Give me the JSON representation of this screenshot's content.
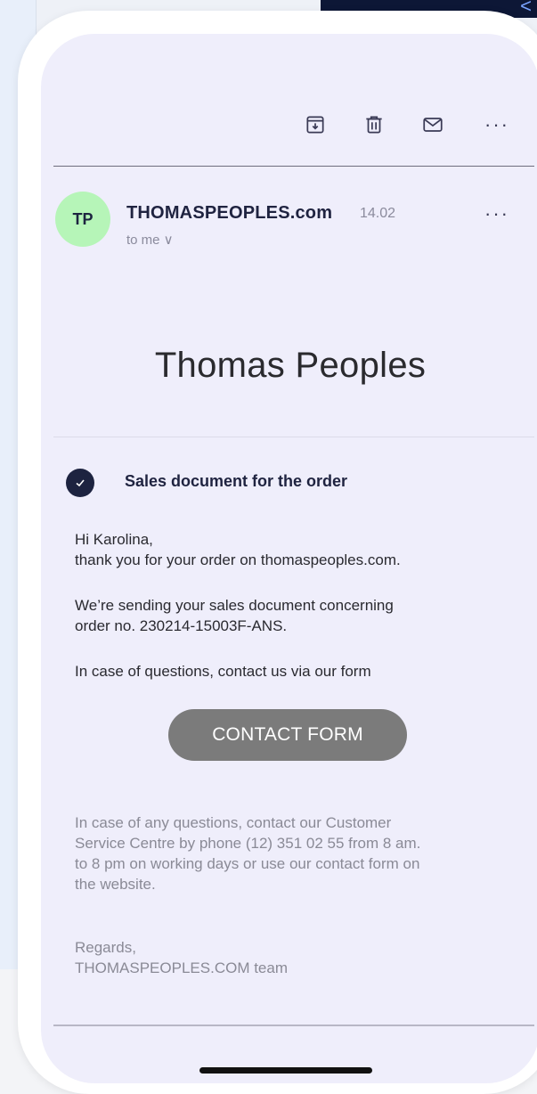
{
  "toolbar": {
    "icons": [
      "archive-icon",
      "trash-icon",
      "mail-icon",
      "more-icon"
    ],
    "more_label": "···"
  },
  "email": {
    "avatar_initials": "TP",
    "sender": "THOMASPEOPLES.com",
    "date": "14.02",
    "to": "to me ∨",
    "more_label": "···"
  },
  "content": {
    "brand": "Thomas Peoples",
    "subject": "Sales document for the order",
    "greeting": "Hi Karolina,",
    "thanks": "thank you for your order on thomaspeoples.com.",
    "sending_1": "We’re sending your sales document concerning",
    "sending_2": "order no. 230214-15003F-ANS.",
    "questions": "In case of questions, contact us via our form",
    "cta_label": "CONTACT FORM",
    "footer_1": "In case of any questions, contact our Customer",
    "footer_2": "Service Centre by phone (12) 351 02 55 from 8 am.",
    "footer_3": "to 8 pm on working days or use our contact form on",
    "footer_4": "the website.",
    "regards": "Regards,",
    "team": "THOMASPEOPLES.COM team"
  },
  "colors": {
    "screen_bg": "#efeefb",
    "avatar_bg": "#b6f5b8",
    "button_bg": "#7b7b7b",
    "check_bg": "#1d2340"
  }
}
